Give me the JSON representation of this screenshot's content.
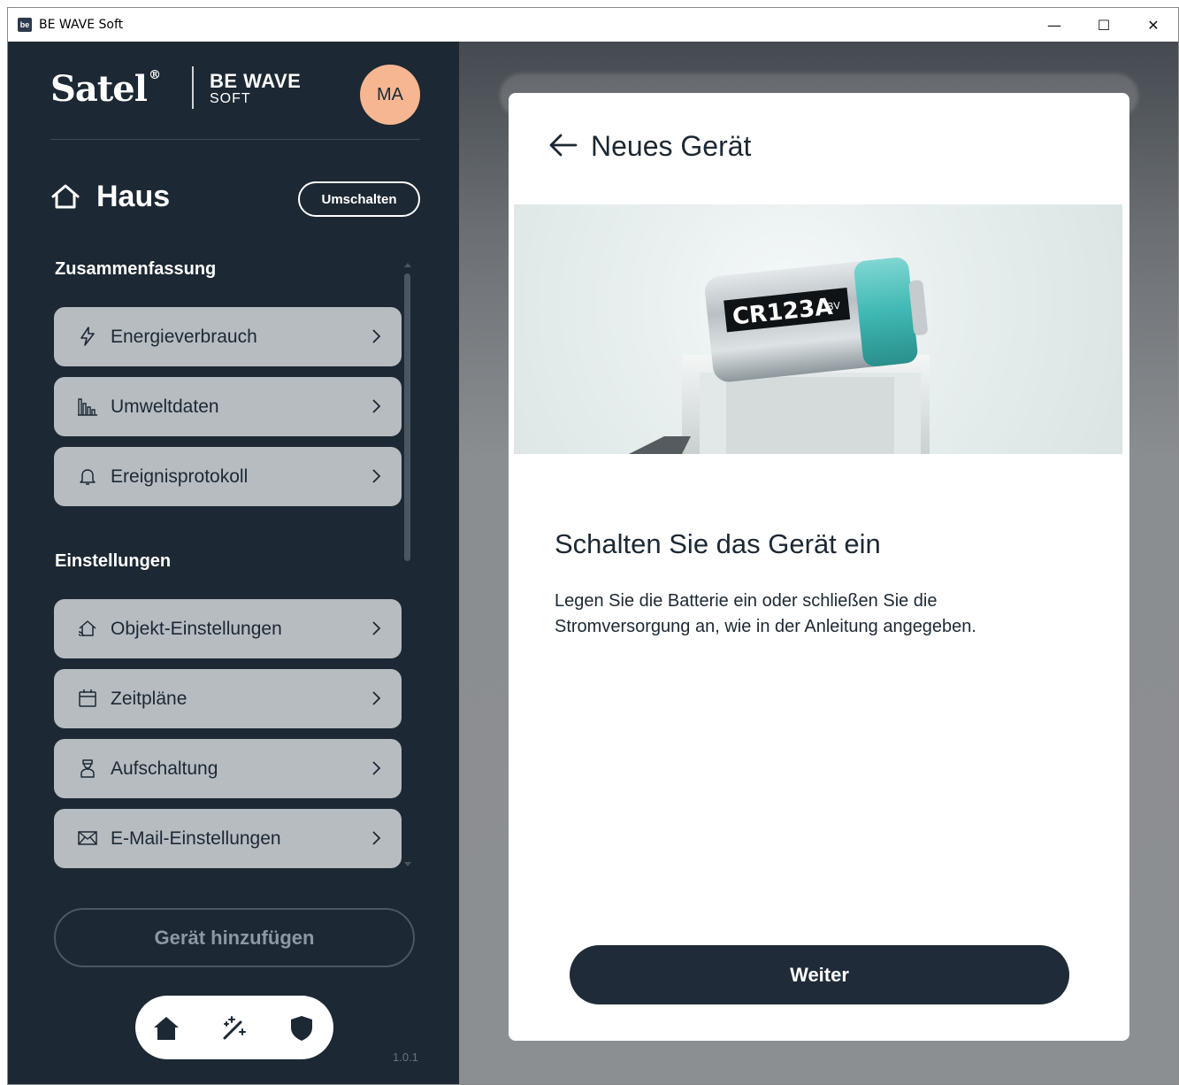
{
  "window": {
    "title": "BE WAVE Soft",
    "app_icon_text": "be",
    "minimize": "—",
    "maximize": "☐",
    "close": "✕"
  },
  "brand": {
    "logo_text": "Satel",
    "logo_mark": "®",
    "product_title": "BE WAVE",
    "product_sub": "SOFT"
  },
  "user": {
    "initials": "MA"
  },
  "house": {
    "name": "Haus",
    "switch_label": "Umschalten"
  },
  "sections": {
    "summary": "Zusammenfassung",
    "settings": "Einstellungen"
  },
  "menu": {
    "summary_items": [
      {
        "label": "Energieverbrauch",
        "icon": "lightning-icon"
      },
      {
        "label": "Umweltdaten",
        "icon": "bar-chart-icon"
      },
      {
        "label": "Ereignisprotokoll",
        "icon": "bell-icon"
      }
    ],
    "settings_items": [
      {
        "label": "Objekt-Einstellungen",
        "icon": "home-wifi-icon"
      },
      {
        "label": "Zeitpläne",
        "icon": "calendar-icon"
      },
      {
        "label": "Aufschaltung",
        "icon": "security-guard-icon"
      },
      {
        "label": "E-Mail-Einstellungen",
        "icon": "envelope-icon"
      }
    ]
  },
  "add_device_label": "Gerät hinzufügen",
  "bottom_nav": [
    "home-icon",
    "magic-wand-icon",
    "shield-icon"
  ],
  "version": "1.0.1",
  "modal": {
    "title": "Neues Gerät",
    "hero_battery_label": "CR123A",
    "hero_battery_voltage": "3V",
    "step_title": "Schalten Sie das Gerät ein",
    "step_desc_line1": "Legen Sie die Batterie ein oder schließen Sie die",
    "step_desc_line2": "Stromversorgung an, wie in der Anleitung angegeben.",
    "next_label": "Weiter"
  },
  "colors": {
    "sidebar_bg": "#1c2833",
    "menu_item_bg": "#b7bcc1",
    "avatar_bg": "#f6b691",
    "primary_button": "#1f2b38"
  }
}
